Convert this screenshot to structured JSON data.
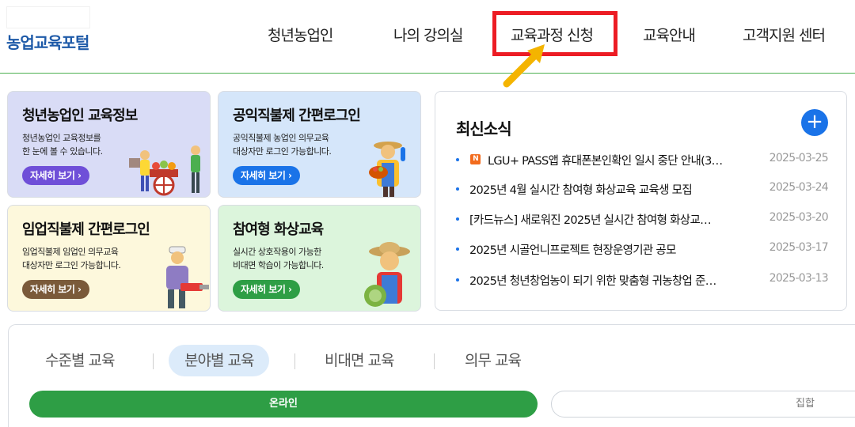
{
  "header": {
    "logo": "농업교육포털",
    "nav": [
      {
        "label": "청년농업인"
      },
      {
        "label": "나의 강의실"
      },
      {
        "label": "교육과정 신청"
      },
      {
        "label": "교육안내"
      },
      {
        "label": "고객지원 센터"
      }
    ]
  },
  "cards": [
    {
      "title": "청년농업인 교육정보",
      "desc1": "청년농업인 교육정보를",
      "desc2": "한 눈에 볼 수 있습니다.",
      "button": "자세히 보기 ›"
    },
    {
      "title": "공익직불제 간편로그인",
      "desc1": "공익직불제 농업인 의무교육",
      "desc2": "대상자만 로그인 가능합니다.",
      "button": "자세히 보기 ›"
    },
    {
      "title": "임업직불제 간편로그인",
      "desc1": "임업직불제 임업인 의무교육",
      "desc2": "대상자만 로그인 가능합니다.",
      "button": "자세히 보기 ›"
    },
    {
      "title": "참여형 화상교육",
      "desc1": "실시간 상호작용이 가능한",
      "desc2": "비대면 학습이 가능합니다.",
      "button": "자세히 보기 ›"
    }
  ],
  "news": {
    "title": "최신소식",
    "plus": "+",
    "badge": "N",
    "items": [
      {
        "text": "LGU+ PASS앱 휴대폰본인확인 일시 중단 안내(3…",
        "date": "2025-03-25"
      },
      {
        "text": "2025년 4월 실시간 참여형 화상교육 교육생 모집",
        "date": "2025-03-24"
      },
      {
        "text": "[카드뉴스] 새로워진 2025년 실시간 참여형 화상교…",
        "date": "2025-03-20"
      },
      {
        "text": "2025년 시골언니프로젝트 현장운영기관 공모",
        "date": "2025-03-17"
      },
      {
        "text": "2025년 청년창업농이 되기 위한 맞춤형 귀농창업 준…",
        "date": "2025-03-13"
      }
    ]
  },
  "course": {
    "tabs": [
      "수준별 교육",
      "분야별 교육",
      "비대면 교육",
      "의무 교육"
    ],
    "segments": {
      "online": "온라인",
      "group": "집합"
    }
  },
  "colors": {
    "brand_blue": "#1e5aa8",
    "highlight_red": "#ec1c24",
    "arrow_yellow": "#f4b400",
    "green": "#2e9e45",
    "accent_blue": "#1a73e8"
  }
}
